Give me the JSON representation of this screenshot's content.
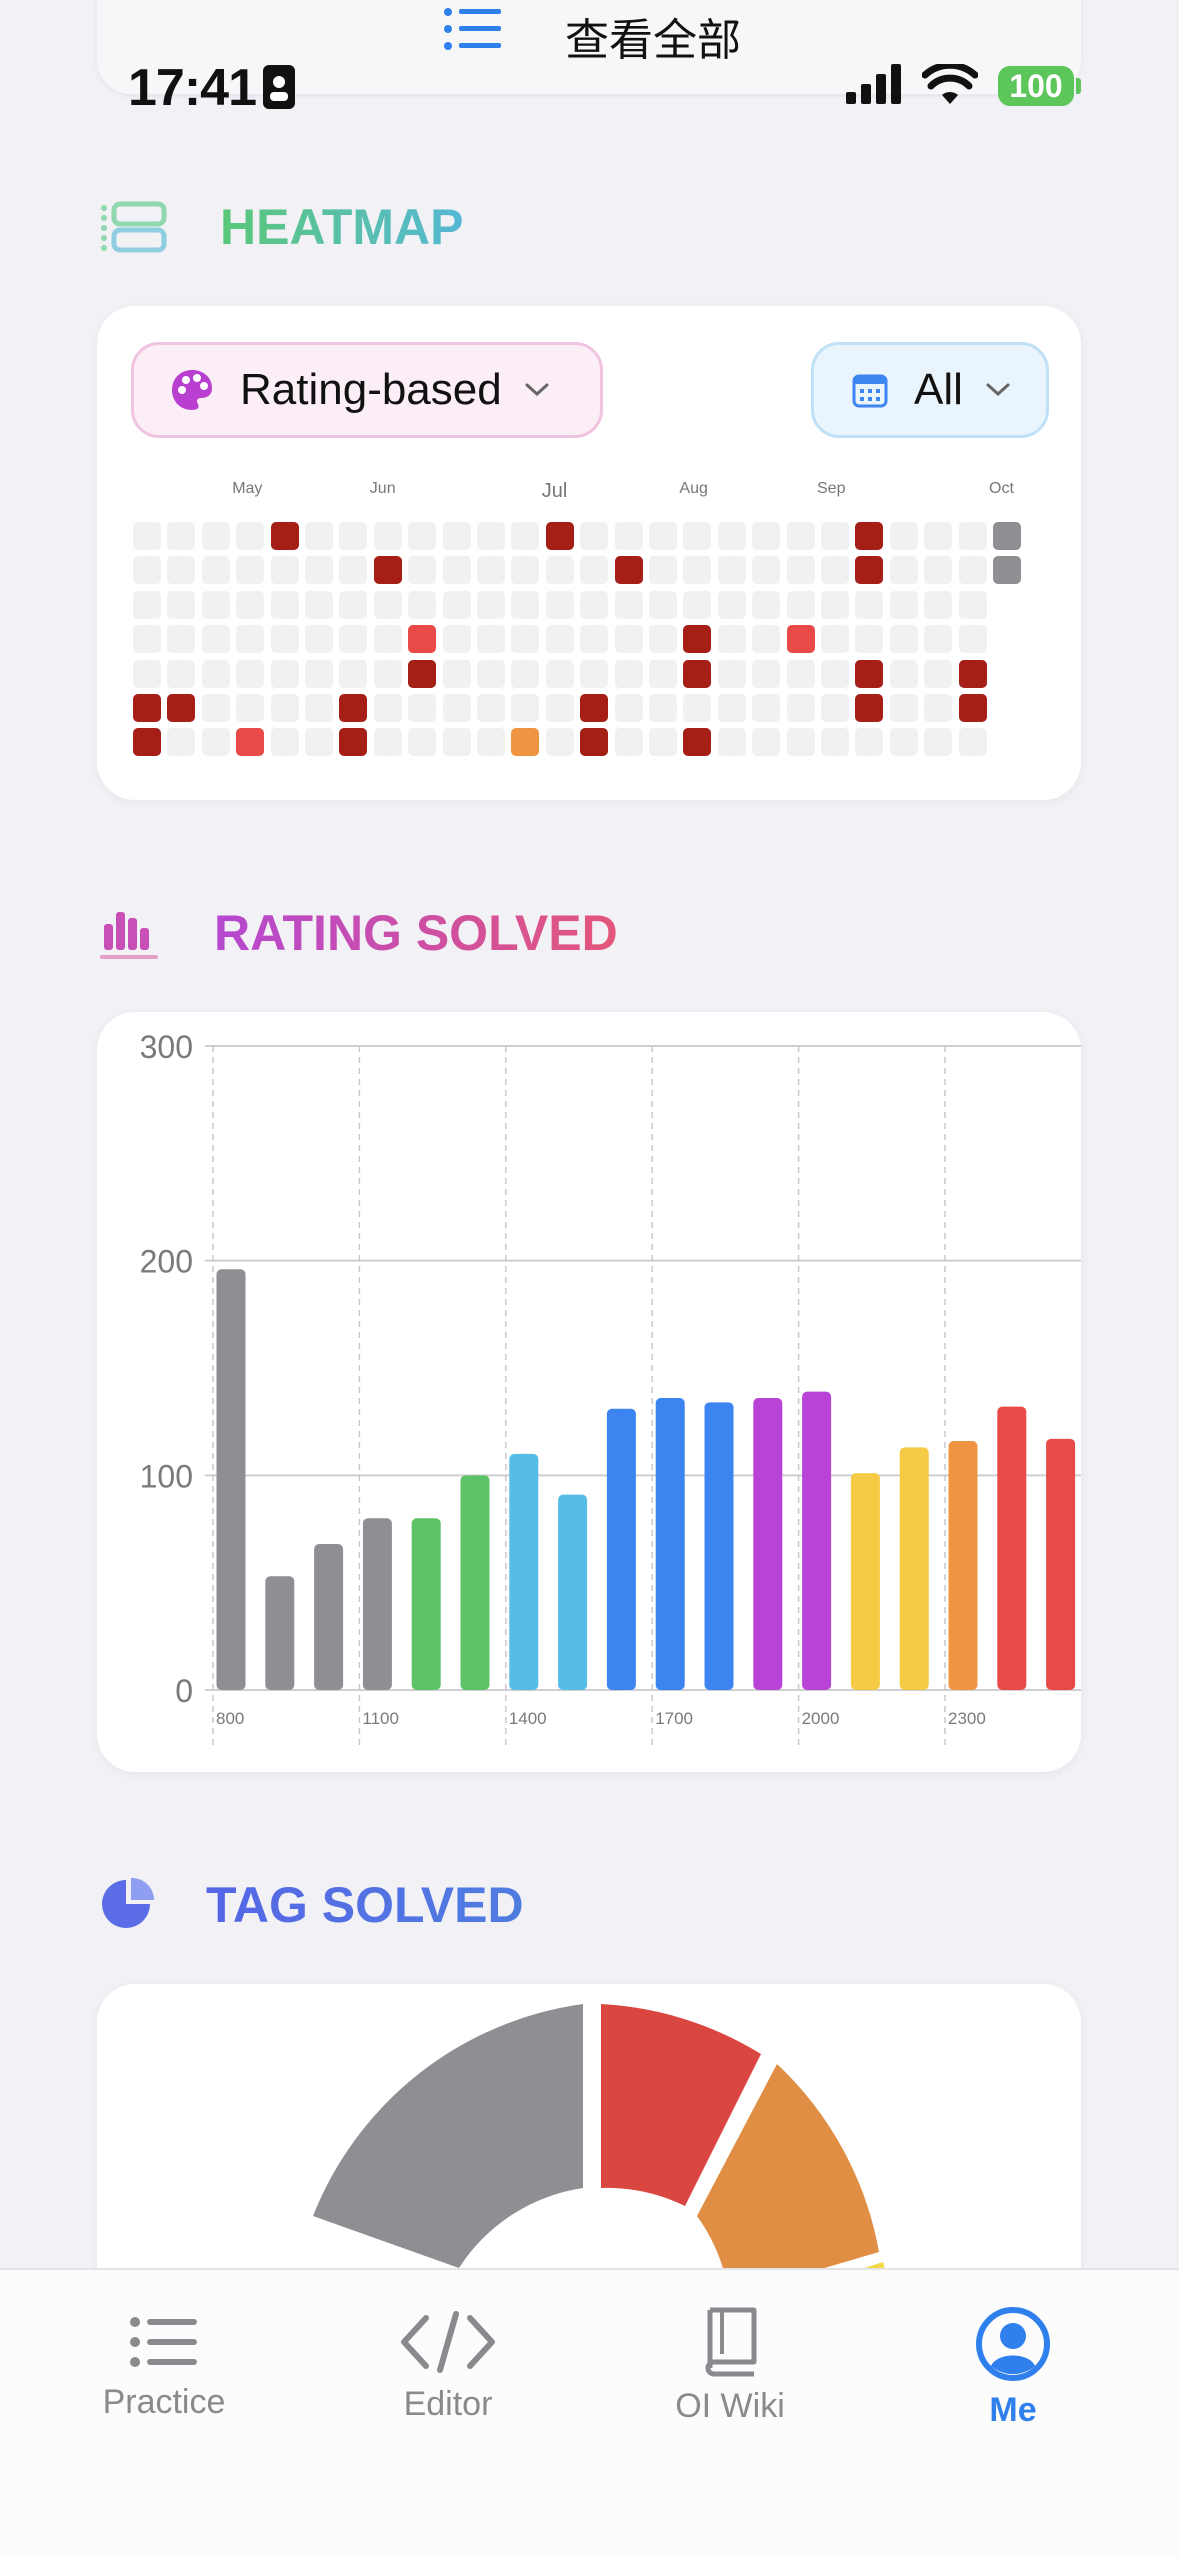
{
  "top_card": {
    "label": "查看全部",
    "icon": "list-icon"
  },
  "status_bar": {
    "time": "17:41",
    "battery": "100"
  },
  "heatmap": {
    "title": "HEATMAP",
    "mode_label": "Rating-based",
    "range_label": "All",
    "months": [
      "May",
      "Jun",
      "Jul",
      "Aug",
      "Sep",
      "Oct"
    ]
  },
  "rating_solved": {
    "title": "RATING SOLVED"
  },
  "tag_solved": {
    "title": "TAG SOLVED"
  },
  "tabs": [
    {
      "label": "Practice",
      "icon": "list-icon"
    },
    {
      "label": "Editor",
      "icon": "code-icon"
    },
    {
      "label": "OI Wiki",
      "icon": "book-icon"
    },
    {
      "label": "Me",
      "icon": "person-circle-icon"
    }
  ],
  "colors": {
    "gray": "#8e8e93",
    "green": "#5ec267",
    "cyan": "#56bde6",
    "blue": "#3c85f0",
    "purple": "#b943d6",
    "yellow": "#f5cb45",
    "orange": "#ef9440",
    "red": "#e84a48",
    "dark_red": "#a51f17",
    "accent": "#2f80ed"
  },
  "chart_data": {
    "type": "bar",
    "title": "",
    "xlabel": "",
    "ylabel": "",
    "ylim": [
      0,
      300
    ],
    "yticks": [
      0,
      100,
      200,
      300
    ],
    "xtick_labels": [
      "800",
      "1100",
      "1400",
      "1700",
      "2000",
      "2300"
    ],
    "categories": [
      "800",
      "900",
      "1000",
      "1100",
      "1200",
      "1300",
      "1400",
      "1500",
      "1600",
      "1700",
      "1800",
      "1900",
      "2000",
      "2100",
      "2200",
      "2300",
      "2400",
      "2500"
    ],
    "values": [
      196,
      53,
      68,
      80,
      80,
      100,
      110,
      91,
      131,
      136,
      134,
      136,
      139,
      101,
      113,
      116,
      132,
      117
    ],
    "bar_colors": [
      "#8e8e93",
      "#8e8e93",
      "#8e8e93",
      "#8e8e93",
      "#5ec267",
      "#5ec267",
      "#56bde6",
      "#56bde6",
      "#3c85f0",
      "#3c85f0",
      "#3c85f0",
      "#b943d6",
      "#b943d6",
      "#f5cb45",
      "#f5cb45",
      "#ef9440",
      "#e84a48",
      "#e84a48"
    ],
    "grid": true
  }
}
